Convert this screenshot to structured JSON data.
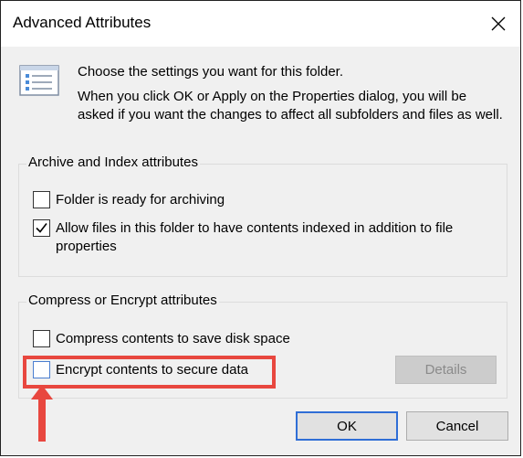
{
  "window": {
    "title": "Advanced Attributes",
    "close_icon": "close-icon"
  },
  "intro": {
    "icon": "folder-settings-icon",
    "line1": "Choose the settings you want for this folder.",
    "line2": "When you click OK or Apply on the Properties dialog, you will be asked if you want the changes to affect all subfolders and files as well."
  },
  "archive_group": {
    "title": "Archive and Index attributes",
    "items": [
      {
        "label": "Folder is ready for archiving",
        "checked": false
      },
      {
        "label": "Allow files in this folder to have contents indexed in addition to file properties",
        "checked": true
      }
    ]
  },
  "compress_group": {
    "title": "Compress or Encrypt attributes",
    "items": [
      {
        "label": "Compress contents to save disk space",
        "checked": false
      },
      {
        "label": "Encrypt contents to secure data",
        "checked": false
      }
    ],
    "details_label": "Details",
    "details_enabled": false
  },
  "buttons": {
    "ok_label": "OK",
    "cancel_label": "Cancel"
  },
  "annotation": {
    "color": "#e8473f",
    "target": "Encrypt contents to secure data"
  },
  "colors": {
    "dialog_bg": "#f0f0f0",
    "default_button_border": "#2f6ed6",
    "checkbox_check": "#000000"
  }
}
